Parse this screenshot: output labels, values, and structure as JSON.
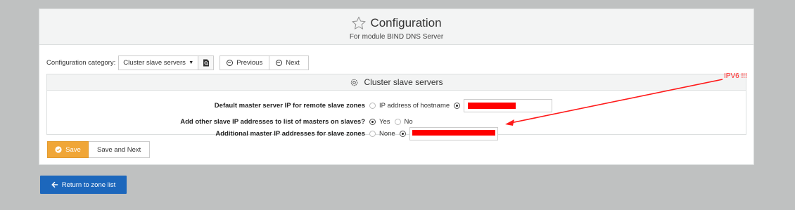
{
  "header": {
    "title": "Configuration",
    "subtitle": "For module BIND DNS Server"
  },
  "category_bar": {
    "label": "Configuration category:",
    "selected": "Cluster slave servers",
    "previous_label": "Previous",
    "next_label": "Next"
  },
  "section": {
    "title": "Cluster slave servers",
    "rows": [
      {
        "label": "Default master server IP for remote slave zones",
        "option_a": "IP address of hostname",
        "option_a_selected": false,
        "option_b_selected": true,
        "value": "[redacted]"
      },
      {
        "label": "Add other slave IP addresses to list of masters on slaves?",
        "option_a": "Yes",
        "option_a_selected": true,
        "option_b": "No",
        "option_b_selected": false
      },
      {
        "label": "Additional master IP addresses for slave zones",
        "option_a": "None",
        "option_a_selected": false,
        "option_b_selected": true,
        "value": "[redacted]"
      }
    ]
  },
  "actions": {
    "save_label": "Save",
    "save_next_label": "Save and Next"
  },
  "return_label": "Return to zone list",
  "annotation": {
    "text": "IPV6 !!!",
    "color": "#ff2020"
  },
  "colors": {
    "save_button": "#f0a637",
    "return_button": "#1c67bc",
    "background": "#bfc1c1"
  }
}
